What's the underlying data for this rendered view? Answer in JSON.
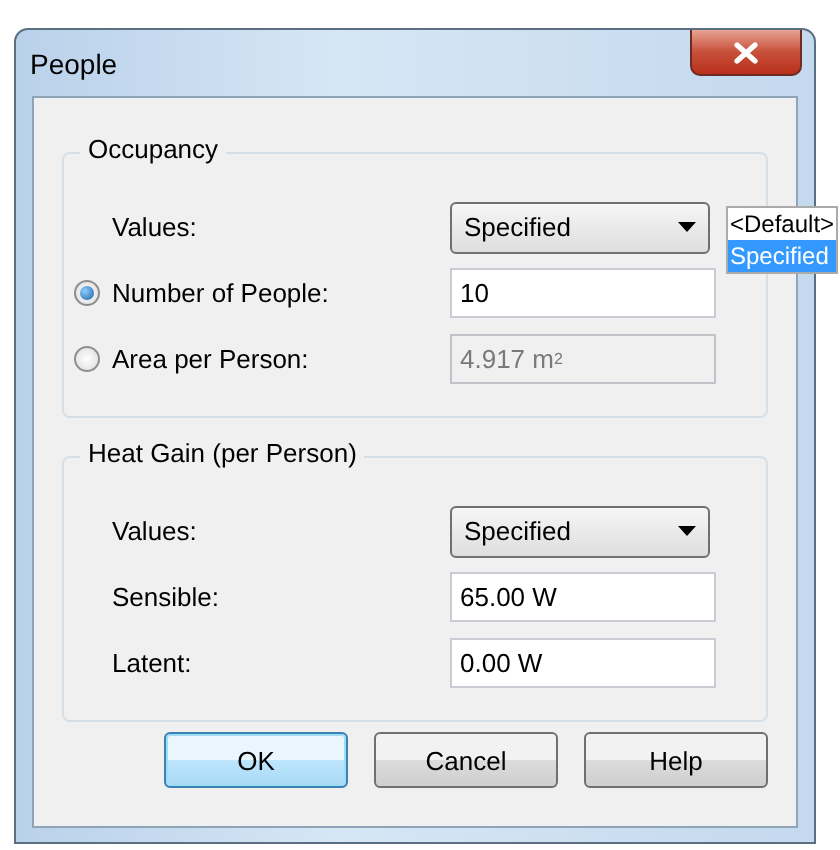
{
  "window": {
    "title": "People"
  },
  "occupancy": {
    "title": "Occupancy",
    "values": {
      "label": "Values:",
      "value": "Specified",
      "dropdown": [
        {
          "label": "<Default>",
          "selected": false
        },
        {
          "label": "Specified",
          "selected": true
        }
      ]
    },
    "options": [
      {
        "label": "Number of People:",
        "selected": true,
        "value": "10",
        "disabled": false
      },
      {
        "label": "Area per Person:",
        "selected": false,
        "value": "4.917 m$^{2}$",
        "disabled": true
      }
    ]
  },
  "heat_gain": {
    "title": "Heat Gain (per Person)",
    "values": {
      "label": "Values:",
      "value": "Specified"
    },
    "fields": [
      {
        "label": "Sensible:",
        "value": "65.00 W"
      },
      {
        "label": "Latent:",
        "value": "0.00 W"
      }
    ]
  },
  "buttons": [
    {
      "label": "OK",
      "default": true
    },
    {
      "label": "Cancel",
      "default": false
    },
    {
      "label": "Help",
      "default": false
    }
  ]
}
